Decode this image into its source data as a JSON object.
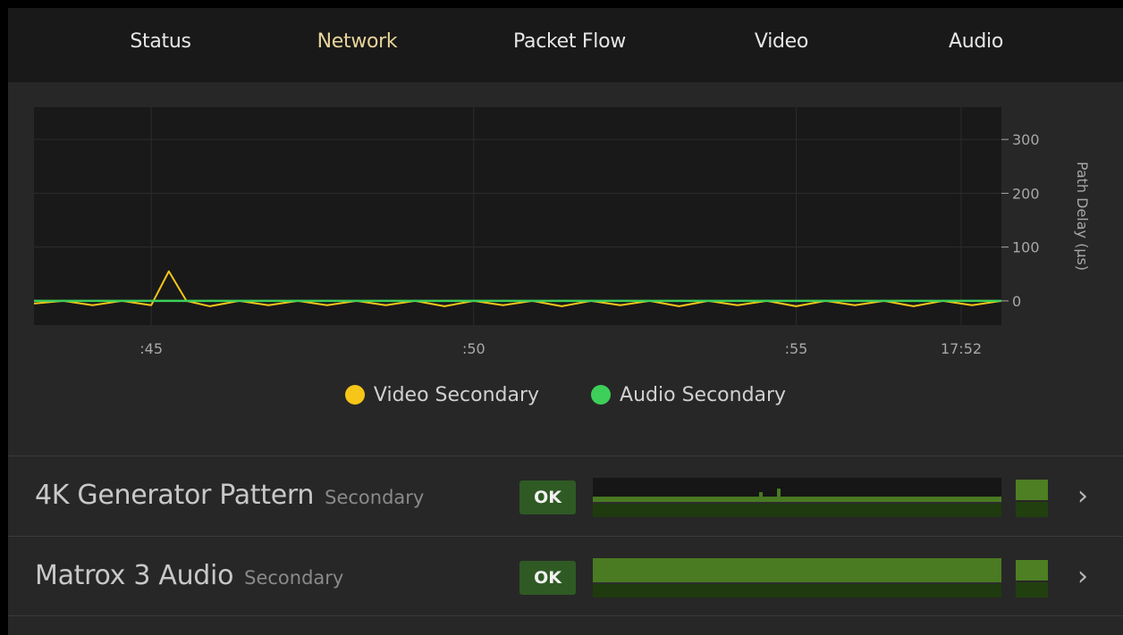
{
  "tabs": [
    {
      "label": "Status",
      "active": false
    },
    {
      "label": "Network",
      "active": true
    },
    {
      "label": "Packet Flow",
      "active": false
    },
    {
      "label": "Video",
      "active": false
    },
    {
      "label": "Audio",
      "active": false
    }
  ],
  "chart_data": {
    "type": "line",
    "ylabel": "Path Delay (µs)",
    "xlabel": "",
    "x_ticks": [
      ":45",
      ":50",
      ":55",
      "17:52"
    ],
    "y_ticks": [
      300,
      200,
      100,
      0
    ],
    "ylim": [
      -45,
      360
    ],
    "grid": true,
    "legend_placement": "bottom-center",
    "series": [
      {
        "name": "Video Secondary",
        "color": "#f5c518",
        "x": [
          0,
          0.5,
          1,
          1.5,
          2,
          2.3,
          2.6,
          3,
          3.5,
          4,
          4.5,
          5,
          5.5,
          6,
          6.5,
          7,
          7.5,
          8,
          8.5,
          9,
          9.5,
          10,
          10.5,
          11,
          11.5,
          12,
          12.5,
          13,
          13.5,
          14,
          14.5,
          15,
          15.5,
          16,
          16.5
        ],
        "values": [
          -5,
          0,
          -8,
          0,
          -8,
          55,
          0,
          -10,
          0,
          -8,
          0,
          -8,
          0,
          -8,
          0,
          -10,
          0,
          -8,
          0,
          -10,
          0,
          -8,
          0,
          -10,
          0,
          -8,
          0,
          -10,
          0,
          -8,
          0,
          -10,
          0,
          -8,
          0
        ]
      },
      {
        "name": "Audio Secondary",
        "color": "#3ecf5a",
        "x": [
          0,
          16.5
        ],
        "values": [
          0,
          0
        ]
      }
    ]
  },
  "chart_colors": {
    "background": "#191919",
    "grid": "#2c2c2c",
    "axis_text": "#a8a8a8"
  },
  "rows": [
    {
      "name": "4K Generator Pattern",
      "subtitle": "Secondary",
      "status": "OK",
      "chevron": "›",
      "spark_fill": 0.22,
      "spark_spikes": true
    },
    {
      "name": "Matrox 3 Audio",
      "subtitle": "Secondary",
      "status": "OK",
      "chevron": "›",
      "spark_fill": 1.0,
      "spark_spikes": false
    }
  ]
}
